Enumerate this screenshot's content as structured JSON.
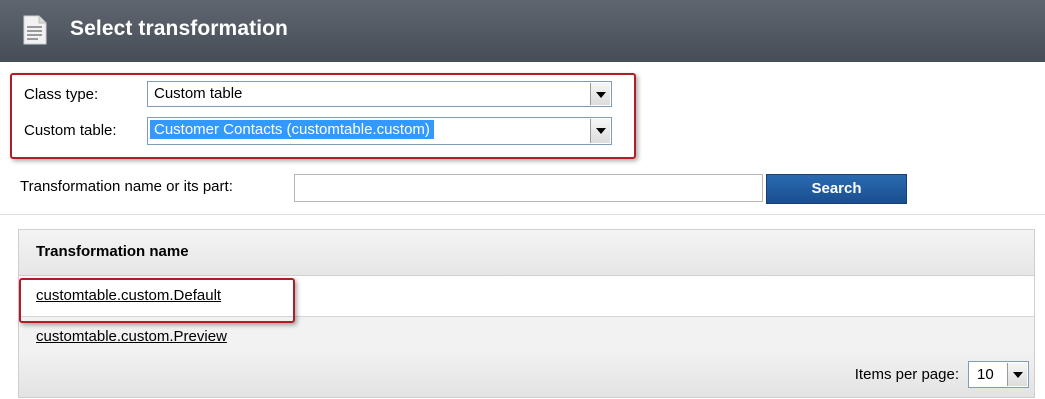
{
  "header": {
    "title": "Select transformation",
    "icon": "document-icon"
  },
  "selectors": {
    "class_type_label": "Class type:",
    "class_type_value": "Custom table",
    "custom_table_label": "Custom table:",
    "custom_table_value": "Customer Contacts (customtable.custom)"
  },
  "filter": {
    "label": "Transformation name or its part:",
    "value": "",
    "search_label": "Search"
  },
  "grid": {
    "column_header": "Transformation name",
    "rows": [
      "customtable.custom.Default",
      "customtable.custom.Preview"
    ],
    "items_per_page_label": "Items per page:",
    "items_per_page_value": "10"
  },
  "colors": {
    "header_bg": "#4f565f",
    "accent": "#1f5b9e",
    "highlight_border": "#b21c25",
    "selection": "#3399ff"
  }
}
